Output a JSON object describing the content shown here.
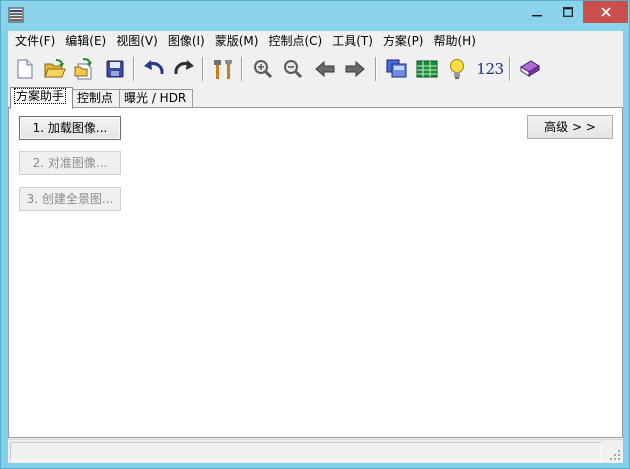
{
  "window": {
    "title": "",
    "icon": "app-icon",
    "controls": {
      "minimize": "minimize-icon",
      "maximize": "maximize-icon",
      "close": "close-icon"
    }
  },
  "menubar": {
    "items": [
      {
        "label": "文件(F)"
      },
      {
        "label": "编辑(E)"
      },
      {
        "label": "视图(V)"
      },
      {
        "label": "图像(I)"
      },
      {
        "label": "蒙版(M)"
      },
      {
        "label": "控制点(C)"
      },
      {
        "label": "工具(T)"
      },
      {
        "label": "方案(P)"
      },
      {
        "label": "帮助(H)"
      }
    ]
  },
  "toolbar": {
    "buttons": [
      {
        "icon": "new-file-icon"
      },
      {
        "icon": "open-folder-icon"
      },
      {
        "icon": "add-images-icon"
      },
      {
        "icon": "save-icon"
      },
      {
        "icon": "undo-icon"
      },
      {
        "icon": "redo-icon"
      },
      {
        "icon": "tools-icon"
      },
      {
        "icon": "zoom-in-icon"
      },
      {
        "icon": "zoom-out-icon"
      },
      {
        "icon": "arrow-left-icon"
      },
      {
        "icon": "arrow-right-icon"
      },
      {
        "icon": "preview-icon"
      },
      {
        "icon": "table-icon"
      },
      {
        "icon": "lightbulb-icon"
      },
      {
        "icon": "numbers-icon",
        "text": "123"
      },
      {
        "icon": "help-book-icon"
      }
    ]
  },
  "tabs": [
    {
      "label": "方案助手",
      "active": true
    },
    {
      "label": "控制点",
      "active": false
    },
    {
      "label": "曝光 / HDR",
      "active": false
    }
  ],
  "assistant": {
    "load_images": "1. 加载图像...",
    "align_images": "2. 对准图像...",
    "create_panorama": "3. 创建全景图...",
    "advanced": "高级 > >"
  },
  "statusbar": {
    "text": ""
  },
  "colors": {
    "titlebar": "#8ad3eb",
    "close_button": "#c7504c",
    "client_background": "#f0f0f0",
    "disabled_text": "#8c8c8c"
  }
}
